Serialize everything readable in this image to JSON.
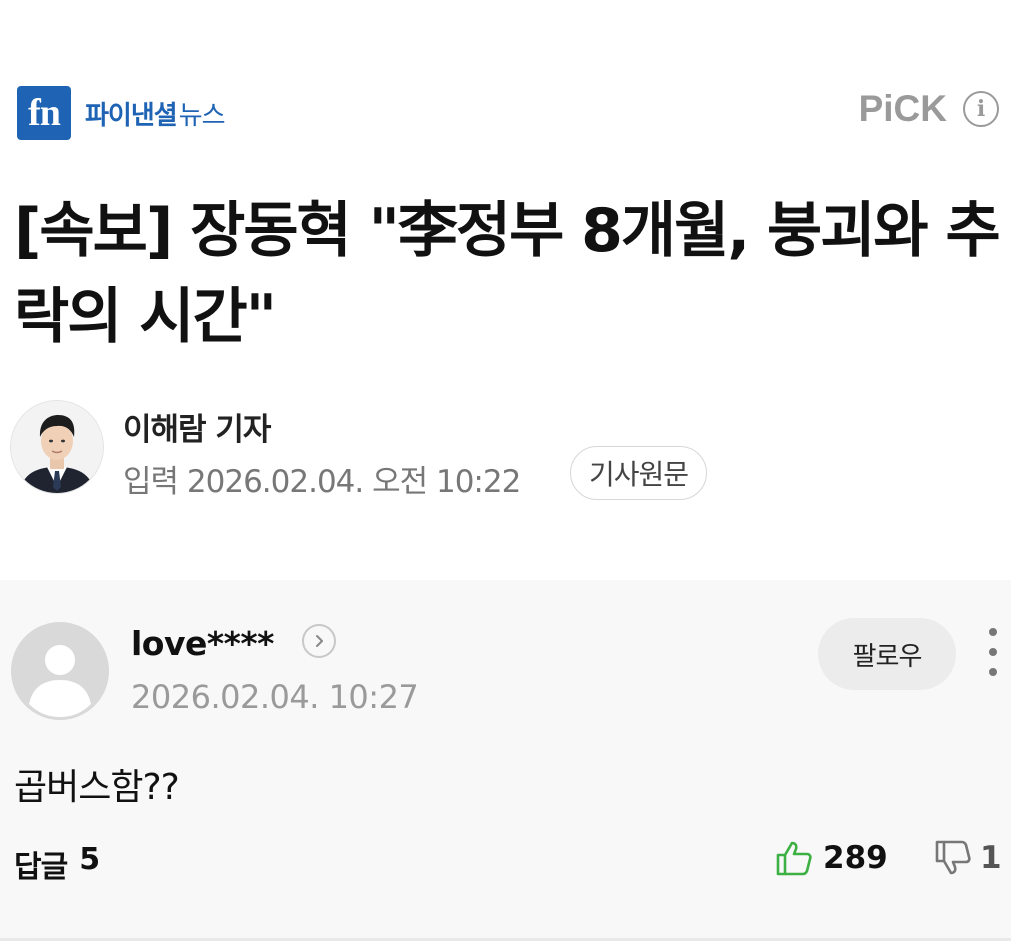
{
  "press": {
    "logo_mark": "fn",
    "name_bold": "파이낸셜",
    "name_light": "뉴스",
    "brand_color": "#1f63b4"
  },
  "pick": {
    "label": "PiCK",
    "info_icon": "i"
  },
  "article": {
    "headline": "[속보] 장동혁 \"李정부 8개월, 붕괴와 추락의 시간\"",
    "author": "이해람 기자",
    "date": "입력 2026.02.04. 오전 10:22",
    "source_button": "기사원문"
  },
  "comment": {
    "username": "love****",
    "timestamp": "2026.02.04. 10:27",
    "follow_label": "팔로우",
    "body": "곱버스함??",
    "reply_label": "답글",
    "reply_count": "5",
    "likes": "289",
    "dislikes": "1",
    "like_color": "#3cb043"
  }
}
